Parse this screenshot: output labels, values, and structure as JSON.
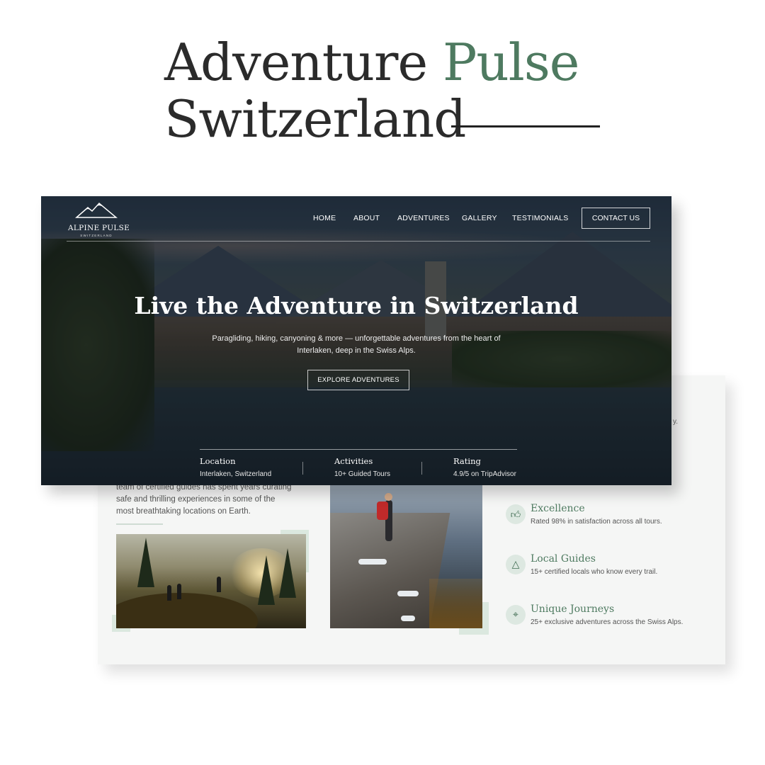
{
  "showcase": {
    "title_part1": "Adventure",
    "title_accent": "Pulse",
    "title_line2": "Switzerland",
    "accent_color": "#4e7a60"
  },
  "hero": {
    "logo": {
      "icon": "mountain-icon",
      "name": "ALPINE PULSE",
      "sub": "SWITZERLAND"
    },
    "nav": [
      "HOME",
      "ABOUT",
      "ADVENTURES",
      "GALLERY",
      "TESTIMONIALS"
    ],
    "contact_label": "CONTACT US",
    "title": "Live the Adventure in Switzerland",
    "subtitle": "Paragliding, hiking, canyoning & more — unforgettable adventures from the heart of Interlaken, deep in the Swiss Alps.",
    "cta_label": "EXPLORE ADVENTURES",
    "stats": [
      {
        "label": "Location",
        "value": "Interlaken, Switzerland"
      },
      {
        "label": "Activities",
        "value": "10+ Guided Tours"
      },
      {
        "label": "Rating",
        "value": "4.9/5 on TripAdvisor"
      }
    ]
  },
  "about": {
    "paragraph": "team of certified guides has spent years curating safe and thrilling experiences in some of the most breathtaking locations on Earth.",
    "edge_text": "y.",
    "features": [
      {
        "icon": "thumbs-up-icon",
        "title": "Excellence",
        "desc": "Rated 98% in satisfaction across all tours."
      },
      {
        "icon": "mountain-outline-icon",
        "title": "Local Guides",
        "desc": "15+ certified locals who know every trail."
      },
      {
        "icon": "map-pin-icon",
        "title": "Unique Journeys",
        "desc": "25+ exclusive adventures across the Swiss Alps."
      }
    ]
  }
}
